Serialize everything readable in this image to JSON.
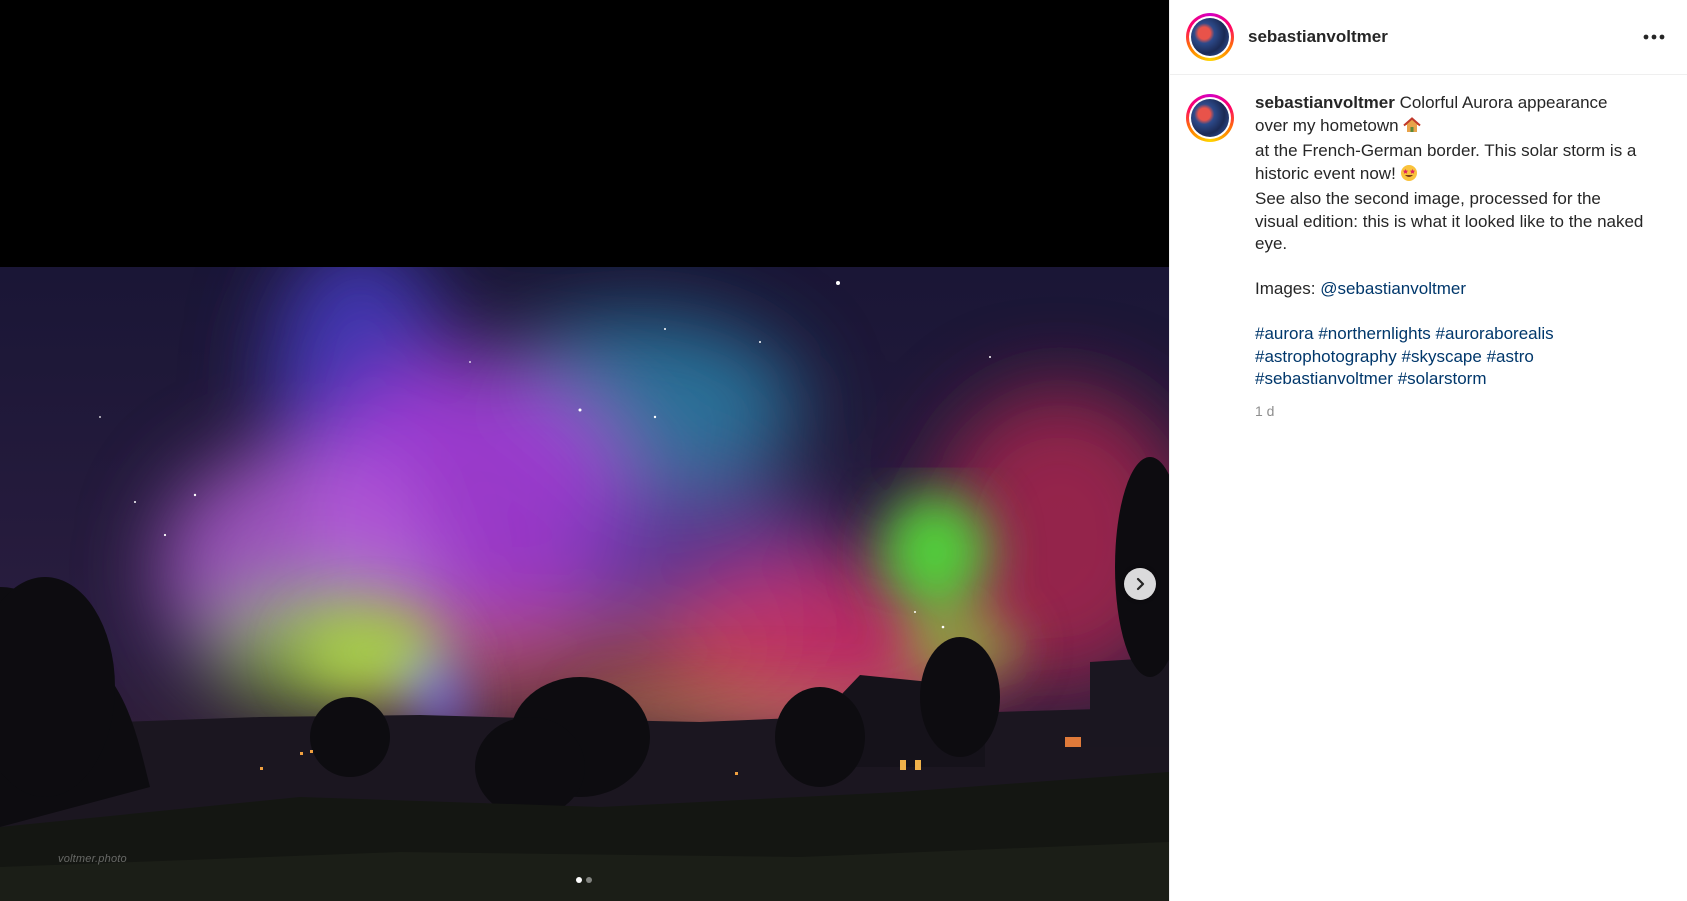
{
  "post": {
    "username": "sebastianvoltmer",
    "caption": {
      "username": "sebastianvoltmer",
      "line1": "Colorful Aurora appearance over my hometown",
      "line2": "at the French-German border. This solar storm is a historic event now!",
      "line3": "See also the second image, processed for the visual edition: this is what it looked like to the naked eye.",
      "images_label": "Images:",
      "images_mention": "@sebastianvoltmer",
      "hashtags": [
        "#aurora",
        "#northernlights",
        "#auroraborealis",
        "#astrophotography",
        "#skyscape",
        "#astro",
        "#sebastianvoltmer",
        "#solarstorm"
      ]
    },
    "timestamp": "1 d",
    "watermark": "voltmer.photo"
  },
  "icons": {
    "more": "more-options-icon",
    "next": "chevron-right-icon",
    "house_emoji": "house-emoji-icon",
    "star_eyes_emoji": "star-struck-emoji-icon"
  },
  "carousel": {
    "total": 2,
    "current": 1
  },
  "colors": {
    "link": "#00376b",
    "text": "#262626",
    "muted": "#8e8e8e"
  }
}
